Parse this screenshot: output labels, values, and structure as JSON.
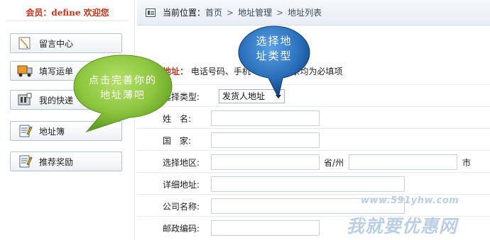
{
  "sidebar": {
    "member_prefix": "会员：",
    "member_name": "define",
    "member_welcome": " 欢迎您",
    "items": [
      {
        "label": "留言中心",
        "icon": "message-note-icon"
      },
      {
        "label": "填写运单",
        "icon": "truck-icon"
      },
      {
        "label": "我的快递",
        "icon": "parcel-icon"
      },
      {
        "label": "地址簿",
        "icon": "address-book-icon"
      },
      {
        "label": "推荐奖励",
        "icon": "reward-icon"
      }
    ]
  },
  "header": {
    "position_label": "当前位置：",
    "breadcrumb": [
      "首页",
      "地址管理",
      "地址列表"
    ],
    "separator": ">"
  },
  "notice": {
    "lead": "地址：",
    "text_a": "电话号码、手机",
    "text_b": "其余均为必填项"
  },
  "form": {
    "type_label": "选择类型:",
    "type_value": "发货人地址",
    "name_label": "姓　名:",
    "country_label": "国　家:",
    "region_label": "选择地区:",
    "province_label": "省/州",
    "city_label": "市",
    "address_label": "详细地址:",
    "company_label": "公司名称:",
    "zip_label": "邮政编码:"
  },
  "tooltips": {
    "green": [
      "点击完善你的",
      "地址薄吧"
    ],
    "blue": [
      "选择地",
      "址类型"
    ]
  },
  "watermark": {
    "url": "www.591yhw.com",
    "text": "我就要优惠网"
  },
  "colors": {
    "accent_red": "#c8341a",
    "bubble_green": "#8cc63e",
    "bubble_blue": "#1f5fa8"
  }
}
